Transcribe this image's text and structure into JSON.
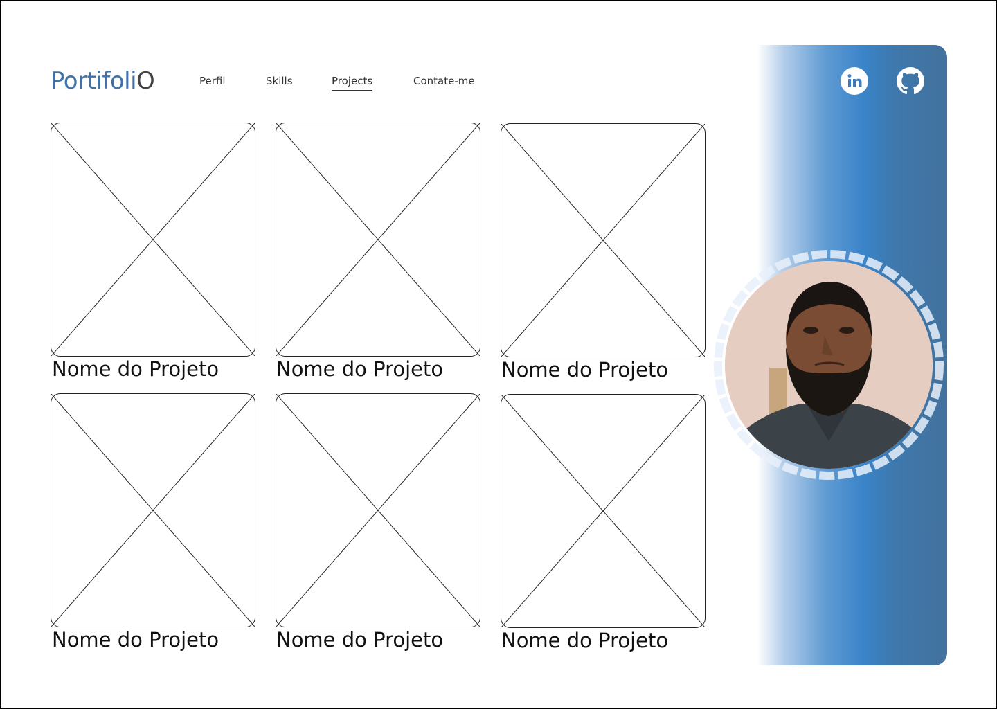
{
  "header": {
    "logo_main": "Portifoli",
    "logo_last": "O",
    "nav": [
      "Perfil",
      "Skills",
      "Projects",
      "Contate-me"
    ],
    "active_nav": "Projects"
  },
  "social": [
    {
      "name": "linkedin",
      "glyph": "in"
    },
    {
      "name": "github",
      "glyph": ""
    }
  ],
  "projects": [
    {
      "title": "Nome do Projeto"
    },
    {
      "title": "Nome do Projeto"
    },
    {
      "title": "Nome do Projeto"
    },
    {
      "title": "Nome do Projeto"
    },
    {
      "title": "Nome do Projeto"
    },
    {
      "title": "Nome do Projeto"
    }
  ],
  "colors": {
    "accent": "#3f72a8",
    "panel_mid": "#3a84c9",
    "panel_dark": "#43729d"
  }
}
